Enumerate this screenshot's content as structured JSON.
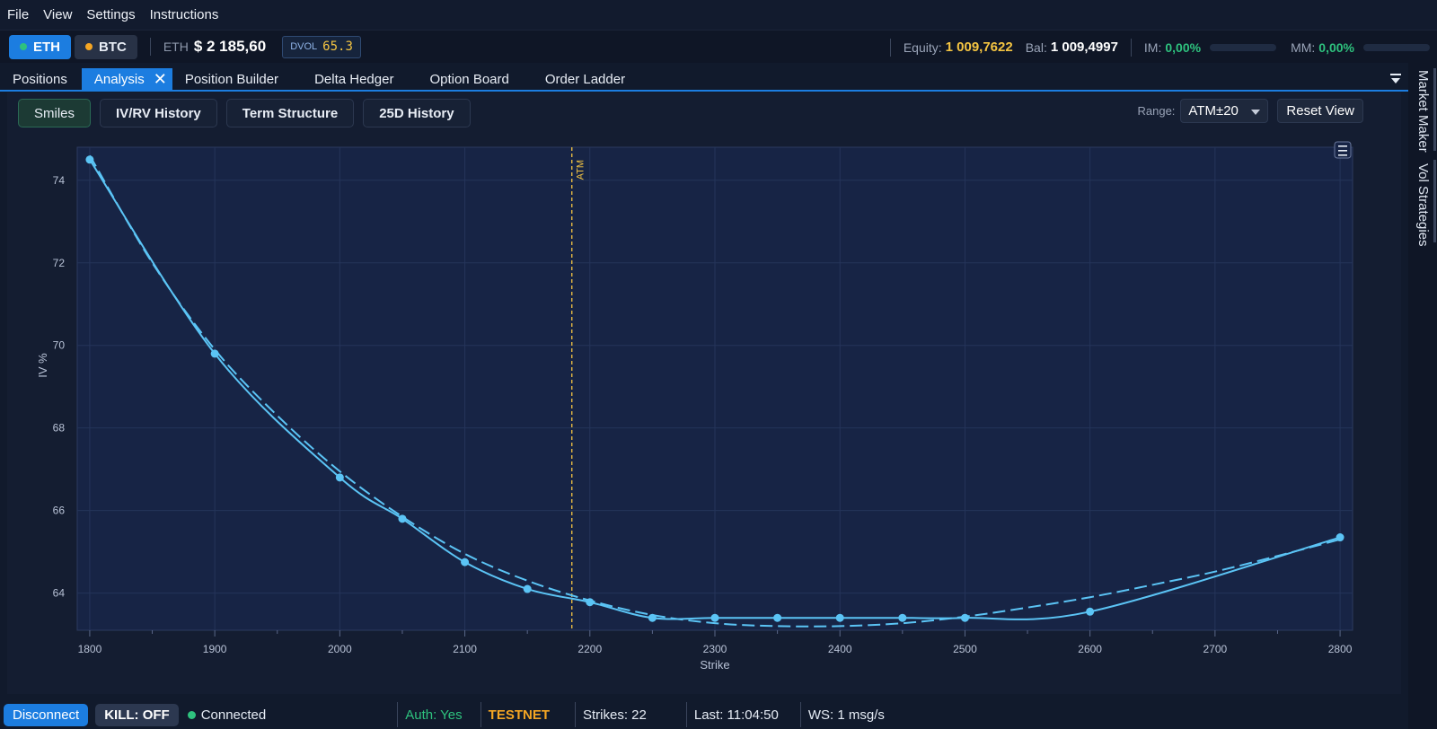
{
  "menu": [
    "File",
    "View",
    "Settings",
    "Instructions"
  ],
  "topbar": {
    "eth_label": "ETH",
    "btc_label": "BTC",
    "eth_dot_color": "#2ec27e",
    "btc_dot_color": "#f5a623",
    "asset_label": "ETH",
    "price": "$ 2 185,60",
    "dvol_label": "DVOL",
    "dvol_value": "65.3",
    "equity_label": "Equity:",
    "equity_value": "1 009,7622",
    "bal_label": "Bal:",
    "bal_value": "1 009,4997",
    "im_label": "IM:",
    "im_value": "0,00%",
    "mm_label": "MM:",
    "mm_value": "0,00%"
  },
  "tabs": [
    "Positions",
    "Analysis",
    "Position Builder",
    "Delta Hedger",
    "Option Board",
    "Order Ladder"
  ],
  "active_tab": "Analysis",
  "right_rail": [
    "Market Maker",
    "Vol Strategies"
  ],
  "subtabs": [
    "Smiles",
    "IV/RV History",
    "Term Structure",
    "25D History"
  ],
  "active_subtab": "Smiles",
  "range": {
    "label": "Range:",
    "value": "ATM±20"
  },
  "reset_label": "Reset View",
  "chart_data": {
    "type": "line",
    "xlabel": "Strike",
    "ylabel": "IV %",
    "xlim": [
      1790,
      2810
    ],
    "ylim": [
      63.1,
      74.8
    ],
    "xticks": [
      1800,
      1900,
      2000,
      2100,
      2200,
      2300,
      2400,
      2500,
      2600,
      2700,
      2800
    ],
    "yticks": [
      64,
      66,
      68,
      70,
      72,
      74
    ],
    "atm_label": "ATM",
    "atm_strike": 2185.6,
    "series": [
      {
        "style": "solid-markers",
        "x": [
          1800,
          1900,
          2000,
          2050,
          2100,
          2150,
          2200,
          2250,
          2300,
          2350,
          2400,
          2450,
          2500,
          2600,
          2800
        ],
        "values": [
          74.5,
          69.8,
          66.8,
          65.8,
          64.75,
          64.1,
          63.78,
          63.4,
          63.4,
          63.4,
          63.4,
          63.4,
          63.4,
          63.55,
          65.35
        ]
      },
      {
        "style": "dashed-fit",
        "x": [
          1800,
          1850,
          1900,
          1950,
          2000,
          2050,
          2100,
          2150,
          2200,
          2250,
          2300,
          2350,
          2400,
          2450,
          2500,
          2550,
          2600,
          2650,
          2700,
          2750,
          2800
        ],
        "values": [
          74.6,
          72.0,
          69.9,
          68.3,
          66.95,
          65.85,
          64.95,
          64.3,
          63.82,
          63.47,
          63.27,
          63.2,
          63.2,
          63.27,
          63.43,
          63.65,
          63.9,
          64.2,
          64.52,
          64.9,
          65.3
        ]
      }
    ],
    "line_color": "#5bc4f5",
    "atm_color": "#f5c542",
    "grid": true
  },
  "status": {
    "disconnect_label": "Disconnect",
    "kill_label": "KILL: OFF",
    "connected_label": "Connected",
    "auth": "Auth: Yes",
    "network": "TESTNET",
    "strikes": "Strikes: 22",
    "last": "Last: 11:04:50",
    "ws": "WS: 1 msg/s"
  }
}
